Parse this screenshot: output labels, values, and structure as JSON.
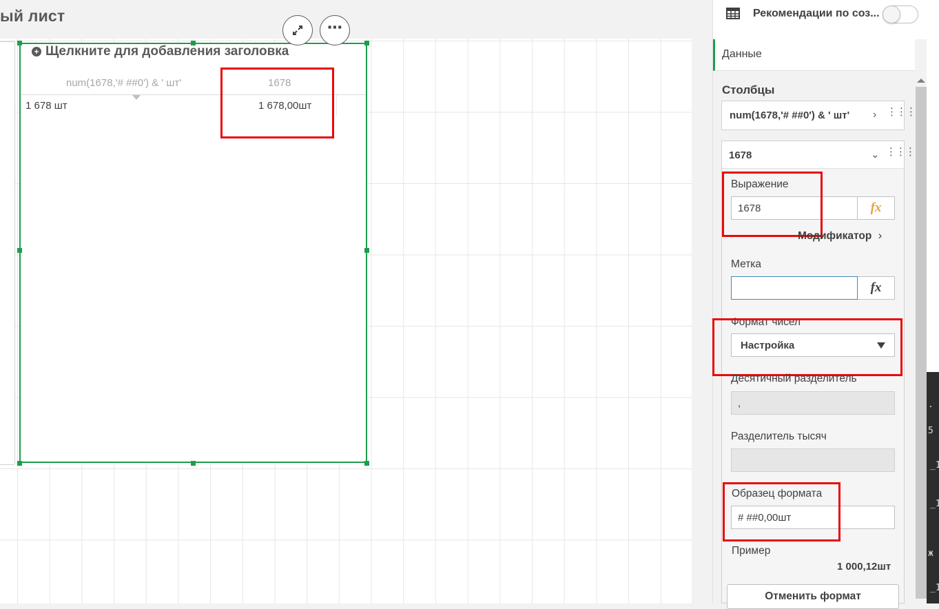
{
  "sheet": {
    "title": "ый лист"
  },
  "object": {
    "title_placeholder": "Щелкните для добавления заголовка",
    "table": {
      "headers": [
        "num(1678,'# ##0') & ' шт'",
        "1678"
      ],
      "rows": [
        [
          "1 678 шт",
          "1 678,00шт"
        ]
      ]
    }
  },
  "panel": {
    "recommendations_label": "Рекомендации по соз...",
    "recommendations_toggle_on": false,
    "data_tab": "Данные",
    "columns_heading": "Столбцы",
    "columns": [
      {
        "label": "num(1678,'# ##0') & ' шт'",
        "expanded": false
      },
      {
        "label": "1678",
        "expanded": true
      }
    ],
    "expression": {
      "label": "Выражение",
      "value": "1678",
      "fx": "fx"
    },
    "modifier_link": "Модификатор",
    "tag": {
      "label": "Метка",
      "value": "",
      "fx": "fx"
    },
    "number_format": {
      "label": "Формат чисел",
      "selected": "Настройка"
    },
    "decimal_separator": {
      "label": "Десятичный разделитель",
      "value": ","
    },
    "thousands_separator": {
      "label": "Разделитель тысяч",
      "value": ""
    },
    "format_pattern": {
      "label": "Образец формата",
      "value": "# ##0,00шт"
    },
    "example": {
      "label": "Пример",
      "value": "1 000,12шт"
    },
    "reset_button": "Отменить формат"
  },
  "colors": {
    "accent_green": "#1d9d4d",
    "highlight_red": "#e8090a",
    "fx_orange": "#e8a33d"
  }
}
